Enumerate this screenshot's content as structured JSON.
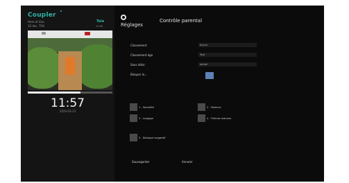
{
  "sidebar": {
    "brand": "Coupler",
    "line1": "Here at Zoo",
    "line2": "10 dec. TV9",
    "channel": "Tele",
    "channel_time": "11:00",
    "preview_header": "HI",
    "progress": 0.62,
    "clock": "11:57",
    "date": "2020-03-13"
  },
  "header": {
    "section": "Réglages",
    "title": "Contrôle parental"
  },
  "form": {
    "rows": [
      {
        "label": "Classement",
        "value": "Aucun"
      },
      {
        "label": "Classement âge",
        "value": "Tout"
      },
      {
        "label": "Sans délai",
        "value": "Activé"
      },
      {
        "label": "Bloquer la...",
        "value": ""
      }
    ]
  },
  "options": {
    "sexualite": "1 - Sexualité",
    "violence": "2 - Violence",
    "langage": "3 - Langage",
    "themes": "4 - Thèmes matures",
    "suggestif": "5 - Dialogue suggestif"
  },
  "buttons": {
    "save": "Sauvegarder",
    "cancel": "Annuler"
  },
  "colors": {
    "accent": "#2fb3a8",
    "checkbox": "#4a4a4a",
    "blocker": "#5e81b5"
  }
}
